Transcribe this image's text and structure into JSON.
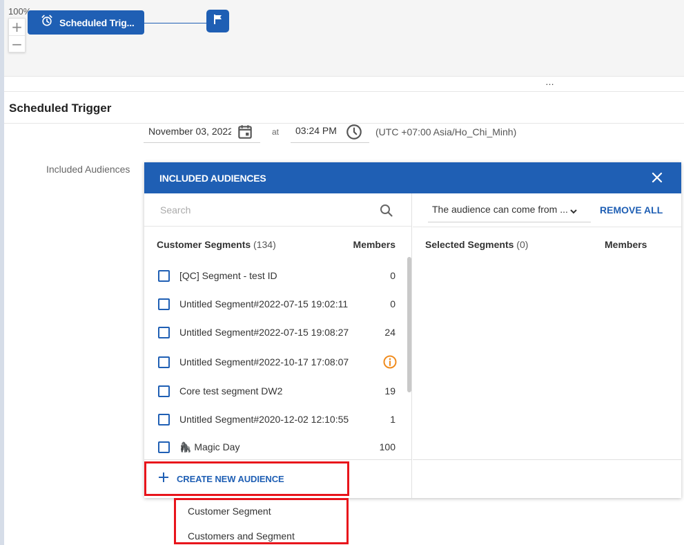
{
  "canvas": {
    "zoom": "100%",
    "zoom_in_label": "+",
    "zoom_out_label": "−",
    "trigger_node_label": "Scheduled Trig...",
    "trigger_node_icon": "alarm-clock-icon",
    "end_node_icon": "flag-icon"
  },
  "resize_handle": "…",
  "section_title": "Scheduled Trigger",
  "schedule": {
    "date": "November 03, 2022",
    "at_label": "at",
    "time": "03:24 PM",
    "timezone": "(UTC +07:00 Asia/Ho_Chi_Minh)"
  },
  "included_label": "Included Audiences",
  "panel": {
    "title": "INCLUDED AUDIENCES",
    "search_placeholder": "Search",
    "list_header": "Customer Segments",
    "list_count": "(134)",
    "members_header": "Members",
    "segments": [
      {
        "name": "[QC] Segment - test ID",
        "members": "0"
      },
      {
        "name": "Untitled Segment#2022-07-15 19:02:11",
        "members": "0"
      },
      {
        "name": "Untitled Segment#2022-07-15 19:08:27",
        "members": "24"
      },
      {
        "name": "Untitled Segment#2022-10-17 17:08:07",
        "members": "",
        "status_icon": "info-icon"
      },
      {
        "name": "Core test segment DW2",
        "members": "19"
      },
      {
        "name": "Untitled Segment#2020-12-02 12:10:55",
        "members": "1"
      },
      {
        "name": "Magic Day",
        "members": "100",
        "emoji": "🦍"
      }
    ],
    "create_button": "CREATE NEW AUDIENCE",
    "audience_source": "The audience can come from ...",
    "remove_all": "REMOVE ALL",
    "selected_header": "Selected Segments",
    "selected_count": "(0)",
    "selected_members_header": "Members"
  },
  "create_menu": {
    "items": [
      "Customer Segment",
      "Customers and Segment"
    ]
  },
  "colors": {
    "primary": "#1f5fb4",
    "highlight": "#e8141b",
    "warning": "#f08c1e"
  }
}
